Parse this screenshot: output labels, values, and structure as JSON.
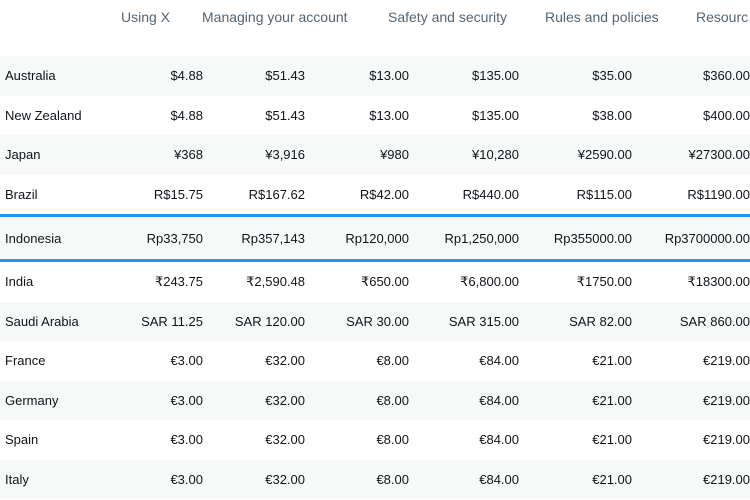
{
  "nav": {
    "items": [
      "Using X",
      "Managing your account",
      "Safety and security",
      "Rules and policies",
      "Resourc"
    ]
  },
  "highlight_color": "#1d9bf0",
  "highlighted_row": "Indonesia",
  "rows": [
    {
      "country": "Australia",
      "values": [
        "$4.88",
        "$51.43",
        "$13.00",
        "$135.00",
        "$35.00",
        "$360.00"
      ]
    },
    {
      "country": "New Zealand",
      "values": [
        "$4.88",
        "$51.43",
        "$13.00",
        "$135.00",
        "$38.00",
        "$400.00"
      ]
    },
    {
      "country": "Japan",
      "values": [
        "¥368",
        "¥3,916",
        "¥980",
        "¥10,280",
        "¥2590.00",
        "¥27300.00"
      ]
    },
    {
      "country": "Brazil",
      "values": [
        "R$15.75",
        "R$167.62",
        "R$42.00",
        "R$440.00",
        "R$115.00",
        "R$1190.00"
      ]
    },
    {
      "country": "Indonesia",
      "values": [
        "Rp33,750",
        "Rp357,143",
        "Rp120,000",
        "Rp1,250,000",
        "Rp355000.00",
        "Rp3700000.00"
      ]
    },
    {
      "country": "India",
      "values": [
        "₹243.75",
        "₹2,590.48",
        "₹650.00",
        "₹6,800.00",
        "₹1750.00",
        "₹18300.00"
      ]
    },
    {
      "country": "Saudi Arabia",
      "values": [
        "SAR 11.25",
        "SAR 120.00",
        "SAR 30.00",
        "SAR 315.00",
        "SAR 82.00",
        "SAR 860.00"
      ]
    },
    {
      "country": "France",
      "values": [
        "€3.00",
        "€32.00",
        "€8.00",
        "€84.00",
        "€21.00",
        "€219.00"
      ]
    },
    {
      "country": "Germany",
      "values": [
        "€3.00",
        "€32.00",
        "€8.00",
        "€84.00",
        "€21.00",
        "€219.00"
      ]
    },
    {
      "country": "Spain",
      "values": [
        "€3.00",
        "€32.00",
        "€8.00",
        "€84.00",
        "€21.00",
        "€219.00"
      ]
    },
    {
      "country": "Italy",
      "values": [
        "€3.00",
        "€32.00",
        "€8.00",
        "€84.00",
        "€21.00",
        "€219.00"
      ]
    }
  ]
}
